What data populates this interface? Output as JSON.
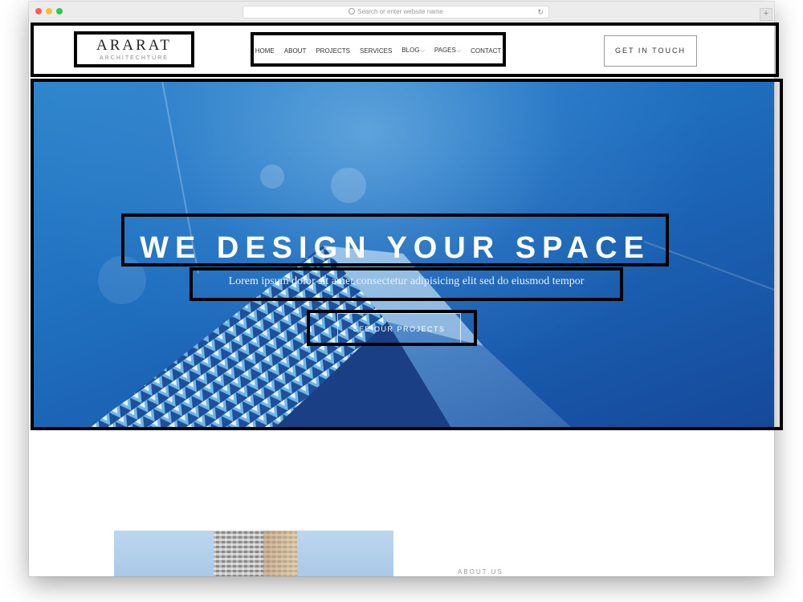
{
  "browser": {
    "address_placeholder": "Search or enter website name",
    "new_tab": "+"
  },
  "header": {
    "logo_title": "ARARAT",
    "logo_subtitle": "ARCHITECHTURE",
    "nav": [
      {
        "label": "HOME",
        "dropdown": false
      },
      {
        "label": "ABOUT",
        "dropdown": false
      },
      {
        "label": "PROJECTS",
        "dropdown": false
      },
      {
        "label": "SERVICES",
        "dropdown": false
      },
      {
        "label": "BLOG",
        "dropdown": true
      },
      {
        "label": "PAGES",
        "dropdown": true
      },
      {
        "label": "CONTACT",
        "dropdown": false
      }
    ],
    "cta_label": "GET IN TOUCH"
  },
  "hero": {
    "title": "WE DESIGN YOUR SPACE",
    "subtitle": "Lorem ipsum dolor sit amet consectetur adipisicing elit sed do eiusmod tempor",
    "button_label": "SEE OUR PROJECTS"
  },
  "about": {
    "label": "ABOUT US"
  },
  "colors": {
    "hero_blue": "#1f6fbf",
    "annotation": "#000000"
  }
}
